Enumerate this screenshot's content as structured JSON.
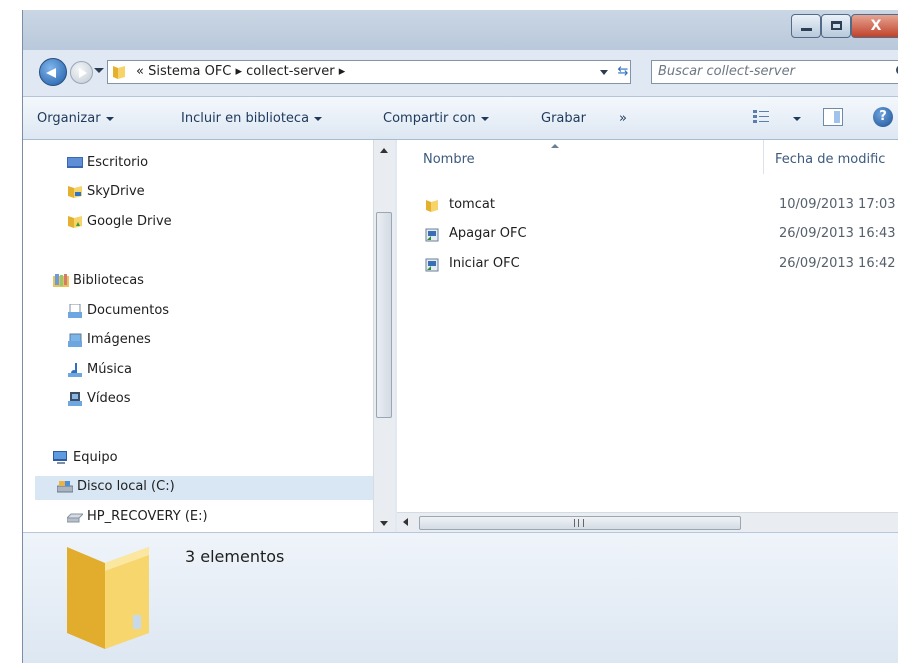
{
  "window": {
    "close_label": "X"
  },
  "address": {
    "text": "« Sistema OFC ▸ collect-server ▸"
  },
  "search": {
    "placeholder": "Buscar collect-server"
  },
  "toolbar": {
    "organize": "Organizar",
    "include_library": "Incluir en biblioteca",
    "share_with": "Compartir con",
    "burn": "Grabar",
    "more": "»",
    "help": "?"
  },
  "sidebar": {
    "items": [
      {
        "label": "Escritorio",
        "icon": "desktop-icon"
      },
      {
        "label": "SkyDrive",
        "icon": "skydrive-icon"
      },
      {
        "label": "Google Drive",
        "icon": "google-drive-icon"
      },
      {
        "label": "Bibliotecas",
        "icon": "libraries-icon"
      },
      {
        "label": "Documentos",
        "icon": "documents-icon"
      },
      {
        "label": "Imágenes",
        "icon": "pictures-icon"
      },
      {
        "label": "Música",
        "icon": "music-icon"
      },
      {
        "label": "Vídeos",
        "icon": "videos-icon"
      },
      {
        "label": "Equipo",
        "icon": "computer-icon"
      },
      {
        "label": "Disco local (C:)",
        "icon": "local-disk-icon"
      },
      {
        "label": "HP_RECOVERY (E:)",
        "icon": "drive-icon"
      }
    ]
  },
  "columns": {
    "name": "Nombre",
    "date": "Fecha de modific"
  },
  "files": [
    {
      "name": "tomcat",
      "date": "10/09/2013 17:03",
      "icon": "folder-icon"
    },
    {
      "name": "Apagar OFC",
      "date": "26/09/2013 16:43",
      "icon": "shortcut-icon"
    },
    {
      "name": "Iniciar OFC",
      "date": "26/09/2013 16:42",
      "icon": "shortcut-icon"
    }
  ],
  "details": {
    "count": "3 elementos"
  },
  "colors": {
    "window_bg": "#dfe8f3",
    "selected_bg": "#d9e6f4",
    "folder_yellow": "#f2c94c",
    "link_blue": "#1e395b"
  }
}
